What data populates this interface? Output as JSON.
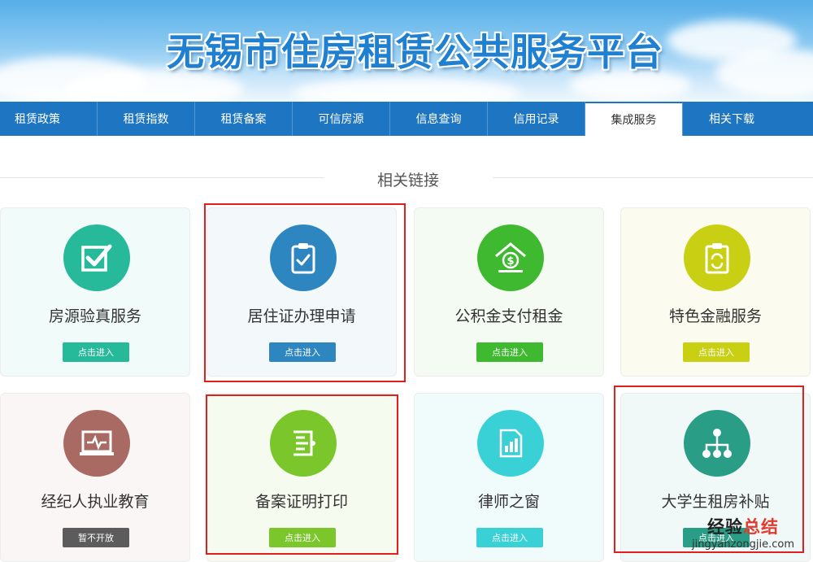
{
  "banner": {
    "title": "无锡市住房租赁公共服务平台"
  },
  "nav": [
    {
      "label": "租赁政策"
    },
    {
      "label": "租赁指数"
    },
    {
      "label": "租赁备案"
    },
    {
      "label": "可信房源"
    },
    {
      "label": "信息查询"
    },
    {
      "label": "信用记录"
    },
    {
      "label": "集成服务",
      "active": true
    },
    {
      "label": "相关下载"
    }
  ],
  "section": {
    "title": "相关链接"
  },
  "cards": [
    {
      "label": "房源验真服务",
      "button": "点击进入",
      "icon": "checkbox-icon",
      "color": "#26b99a",
      "bg": "#f0fbfa"
    },
    {
      "label": "居住证办理申请",
      "button": "点击进入",
      "icon": "clipboard-check-icon",
      "color": "#2e86c1",
      "bg": "#f3f8fb"
    },
    {
      "label": "公积金支付租金",
      "button": "点击进入",
      "icon": "dollar-house-icon",
      "color": "#3fb92f",
      "bg": "#f4fbf2"
    },
    {
      "label": "特色金融服务",
      "button": "点击进入",
      "icon": "refresh-clipboard-icon",
      "color": "#c9cf12",
      "bg": "#fbfbef"
    },
    {
      "label": "经纪人执业教育",
      "button": "暂不开放",
      "icon": "monitor-icon",
      "color": "#a86a62",
      "bg": "#fbf6f6",
      "btn_color": "#5c5c5c"
    },
    {
      "label": "备案证明打印",
      "button": "点击进入",
      "icon": "document-icon",
      "color": "#7bc72b",
      "bg": "#f6fbef"
    },
    {
      "label": "律师之窗",
      "button": "点击进入",
      "icon": "chart-document-icon",
      "color": "#39d1d6",
      "bg": "#f0fbfc"
    },
    {
      "label": "大学生租房补贴",
      "button": "点击进入",
      "icon": "hierarchy-icon",
      "color": "#2a9d86",
      "bg": "#f0f9f7"
    }
  ],
  "watermark": {
    "cn_a": "经验",
    "cn_b": "总结",
    "en": "jingyanzongjie.com"
  }
}
